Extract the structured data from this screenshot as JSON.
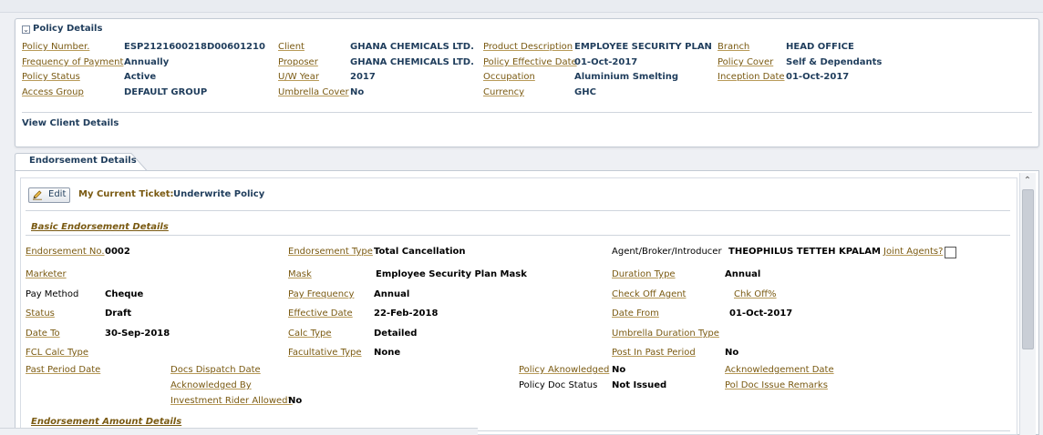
{
  "policy_panel": {
    "title": "Policy Details",
    "toggle_glyph": "⌄",
    "fields": {
      "policy_number": {
        "label": "Policy Number.",
        "value": "ESP2121600218D00601210"
      },
      "frequency_of_payment": {
        "label": "Frequency of Payment",
        "value": "Annually"
      },
      "policy_status": {
        "label": "Policy Status",
        "value": "Active"
      },
      "access_group": {
        "label": "Access Group",
        "value": "DEFAULT GROUP"
      },
      "client": {
        "label": "Client",
        "value": "GHANA CHEMICALS LTD."
      },
      "proposer": {
        "label": "Proposer",
        "value": "GHANA CHEMICALS LTD."
      },
      "uw_year": {
        "label": "U/W Year",
        "value": "2017"
      },
      "umbrella_cover": {
        "label": "Umbrella Cover",
        "value": "No"
      },
      "product_description": {
        "label": "Product Description",
        "value": "EMPLOYEE SECURITY PLAN"
      },
      "policy_effective_date": {
        "label": "Policy Effective Date",
        "value": "01-Oct-2017"
      },
      "occupation": {
        "label": "Occupation",
        "value": "Aluminium Smelting"
      },
      "currency": {
        "label": "Currency",
        "value": "GHC"
      },
      "branch": {
        "label": "Branch",
        "value": "HEAD OFFICE"
      },
      "policy_cover": {
        "label": "Policy Cover",
        "value": "Self & Dependants"
      },
      "inception_date": {
        "label": "Inception Date",
        "value": "01-Oct-2017"
      }
    },
    "view_client_link": "View Client Details"
  },
  "endorsement_tab": {
    "label": "Endorsement Details"
  },
  "toolbar": {
    "edit_label": "Edit",
    "ticket_label": "My Current Ticket:",
    "ticket_value": "Underwrite Policy"
  },
  "basic_section": {
    "title": "Basic Endorsement Details",
    "fields": {
      "endorsement_no": {
        "label": "Endorsement No.",
        "value": "0002"
      },
      "marketer": {
        "label": "Marketer",
        "value": ""
      },
      "pay_method": {
        "label": "Pay Method",
        "value": "Cheque"
      },
      "status": {
        "label": "Status",
        "value": "Draft"
      },
      "date_to": {
        "label": "Date To",
        "value": "30-Sep-2018"
      },
      "fcl_calc_type": {
        "label": "FCL Calc Type",
        "value": ""
      },
      "past_period_date": {
        "label": "Past Period Date",
        "value": ""
      },
      "endorsement_type": {
        "label": "Endorsement Type",
        "value": "Total Cancellation"
      },
      "mask": {
        "label": "Mask",
        "value": "Employee Security Plan Mask"
      },
      "pay_frequency": {
        "label": "Pay Frequency",
        "value": "Annual"
      },
      "effective_date": {
        "label": "Effective Date",
        "value": "22-Feb-2018"
      },
      "calc_type": {
        "label": "Calc Type",
        "value": "Detailed"
      },
      "facultative_type": {
        "label": "Facultative Type",
        "value": "None"
      },
      "agent": {
        "label": "Agent/Broker/Introducer",
        "value": "THEOPHILUS TETTEH KPALAM"
      },
      "joint_agents": {
        "label": "Joint Agents?",
        "checked": false
      },
      "duration_type": {
        "label": "Duration Type",
        "value": "Annual"
      },
      "check_off_agent": {
        "label": "Check Off Agent",
        "value": ""
      },
      "chk_off": {
        "label": "Chk Off%",
        "value": ""
      },
      "date_from": {
        "label": "Date From",
        "value": "01-Oct-2017"
      },
      "umbrella_duration_type": {
        "label": "Umbrella Duration Type",
        "value": ""
      },
      "post_in_past_period": {
        "label": "Post In Past Period",
        "value": "No"
      },
      "docs_dispatch_date": {
        "label": "Docs Dispatch Date",
        "value": ""
      },
      "acknowledged_by": {
        "label": "Acknowledged By",
        "value": ""
      },
      "investment_rider_allowed": {
        "label": "Investment Rider Allowed?",
        "value": "No"
      },
      "policy_acknowledged": {
        "label": "Policy Aknowledged",
        "value": "No"
      },
      "policy_doc_status": {
        "label": "Policy Doc Status",
        "value": "Not Issued"
      },
      "acknowledgement_date": {
        "label": "Acknowledgement Date",
        "value": ""
      },
      "pol_doc_issue_remarks": {
        "label": "Pol Doc Issue Remarks",
        "value": ""
      }
    }
  },
  "amount_section": {
    "title": "Endorsement Amount Details"
  },
  "scrollbar": {
    "up_glyph": "⌃"
  },
  "colors": {
    "label": "#7a5a12",
    "value_link": "#1f3d5c",
    "panel_border": "#c3cad4"
  }
}
